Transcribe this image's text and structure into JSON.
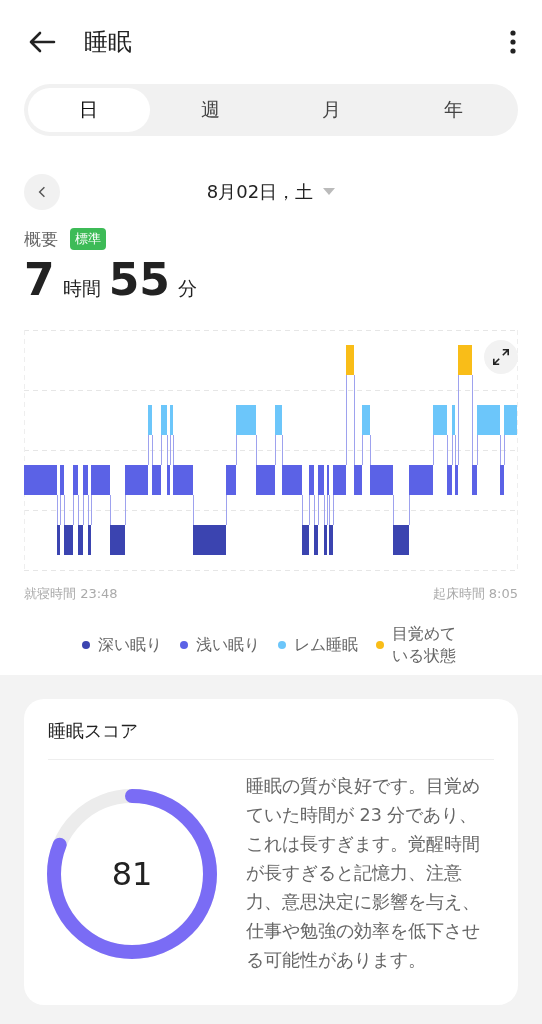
{
  "header": {
    "title": "睡眠"
  },
  "tabs": [
    {
      "label": "日",
      "selected": true
    },
    {
      "label": "週",
      "selected": false
    },
    {
      "label": "月",
      "selected": false
    },
    {
      "label": "年",
      "selected": false
    }
  ],
  "date": {
    "label": "8月02日，土"
  },
  "summary": {
    "label": "概要",
    "badge": "標準",
    "hours": "7",
    "hours_unit": "時間",
    "minutes": "55",
    "minutes_unit": "分"
  },
  "times": {
    "bedtime": "就寝時間 23:48",
    "wake": "起床時間 8:05"
  },
  "legend": [
    {
      "label": "深い眠り",
      "color": "#3b44b0"
    },
    {
      "label": "浅い眠り",
      "color": "#5b62e6"
    },
    {
      "label": "レム睡眠",
      "color": "#6cc6fa"
    },
    {
      "label": "目覚めている状態",
      "color": "#f9bd18"
    }
  ],
  "score_card": {
    "title": "睡眠スコア",
    "score": "81",
    "level": 0.81,
    "text": "睡眠の質が良好です。目覚めていた時間が 23 分であり、これは長すぎます。覚醒時間が長すぎると記憶力、注意力、意思決定に影響を与え、仕事や勉強の効率を低下させる可能性があります。"
  }
}
